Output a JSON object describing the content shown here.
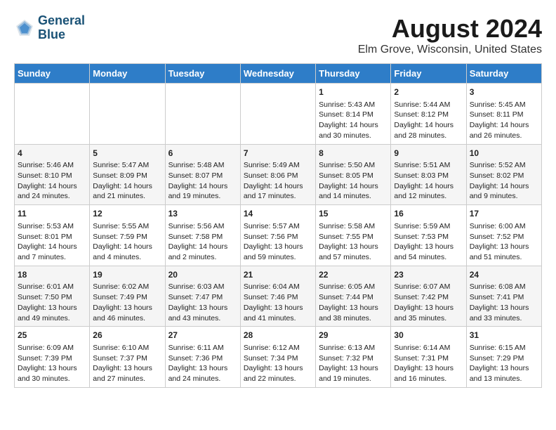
{
  "header": {
    "logo_line1": "General",
    "logo_line2": "Blue",
    "title": "August 2024",
    "subtitle": "Elm Grove, Wisconsin, United States"
  },
  "calendar": {
    "days_of_week": [
      "Sunday",
      "Monday",
      "Tuesday",
      "Wednesday",
      "Thursday",
      "Friday",
      "Saturday"
    ],
    "weeks": [
      [
        {
          "day": "",
          "info": ""
        },
        {
          "day": "",
          "info": ""
        },
        {
          "day": "",
          "info": ""
        },
        {
          "day": "",
          "info": ""
        },
        {
          "day": "1",
          "info": "Sunrise: 5:43 AM\nSunset: 8:14 PM\nDaylight: 14 hours\nand 30 minutes."
        },
        {
          "day": "2",
          "info": "Sunrise: 5:44 AM\nSunset: 8:12 PM\nDaylight: 14 hours\nand 28 minutes."
        },
        {
          "day": "3",
          "info": "Sunrise: 5:45 AM\nSunset: 8:11 PM\nDaylight: 14 hours\nand 26 minutes."
        }
      ],
      [
        {
          "day": "4",
          "info": "Sunrise: 5:46 AM\nSunset: 8:10 PM\nDaylight: 14 hours\nand 24 minutes."
        },
        {
          "day": "5",
          "info": "Sunrise: 5:47 AM\nSunset: 8:09 PM\nDaylight: 14 hours\nand 21 minutes."
        },
        {
          "day": "6",
          "info": "Sunrise: 5:48 AM\nSunset: 8:07 PM\nDaylight: 14 hours\nand 19 minutes."
        },
        {
          "day": "7",
          "info": "Sunrise: 5:49 AM\nSunset: 8:06 PM\nDaylight: 14 hours\nand 17 minutes."
        },
        {
          "day": "8",
          "info": "Sunrise: 5:50 AM\nSunset: 8:05 PM\nDaylight: 14 hours\nand 14 minutes."
        },
        {
          "day": "9",
          "info": "Sunrise: 5:51 AM\nSunset: 8:03 PM\nDaylight: 14 hours\nand 12 minutes."
        },
        {
          "day": "10",
          "info": "Sunrise: 5:52 AM\nSunset: 8:02 PM\nDaylight: 14 hours\nand 9 minutes."
        }
      ],
      [
        {
          "day": "11",
          "info": "Sunrise: 5:53 AM\nSunset: 8:01 PM\nDaylight: 14 hours\nand 7 minutes."
        },
        {
          "day": "12",
          "info": "Sunrise: 5:55 AM\nSunset: 7:59 PM\nDaylight: 14 hours\nand 4 minutes."
        },
        {
          "day": "13",
          "info": "Sunrise: 5:56 AM\nSunset: 7:58 PM\nDaylight: 14 hours\nand 2 minutes."
        },
        {
          "day": "14",
          "info": "Sunrise: 5:57 AM\nSunset: 7:56 PM\nDaylight: 13 hours\nand 59 minutes."
        },
        {
          "day": "15",
          "info": "Sunrise: 5:58 AM\nSunset: 7:55 PM\nDaylight: 13 hours\nand 57 minutes."
        },
        {
          "day": "16",
          "info": "Sunrise: 5:59 AM\nSunset: 7:53 PM\nDaylight: 13 hours\nand 54 minutes."
        },
        {
          "day": "17",
          "info": "Sunrise: 6:00 AM\nSunset: 7:52 PM\nDaylight: 13 hours\nand 51 minutes."
        }
      ],
      [
        {
          "day": "18",
          "info": "Sunrise: 6:01 AM\nSunset: 7:50 PM\nDaylight: 13 hours\nand 49 minutes."
        },
        {
          "day": "19",
          "info": "Sunrise: 6:02 AM\nSunset: 7:49 PM\nDaylight: 13 hours\nand 46 minutes."
        },
        {
          "day": "20",
          "info": "Sunrise: 6:03 AM\nSunset: 7:47 PM\nDaylight: 13 hours\nand 43 minutes."
        },
        {
          "day": "21",
          "info": "Sunrise: 6:04 AM\nSunset: 7:46 PM\nDaylight: 13 hours\nand 41 minutes."
        },
        {
          "day": "22",
          "info": "Sunrise: 6:05 AM\nSunset: 7:44 PM\nDaylight: 13 hours\nand 38 minutes."
        },
        {
          "day": "23",
          "info": "Sunrise: 6:07 AM\nSunset: 7:42 PM\nDaylight: 13 hours\nand 35 minutes."
        },
        {
          "day": "24",
          "info": "Sunrise: 6:08 AM\nSunset: 7:41 PM\nDaylight: 13 hours\nand 33 minutes."
        }
      ],
      [
        {
          "day": "25",
          "info": "Sunrise: 6:09 AM\nSunset: 7:39 PM\nDaylight: 13 hours\nand 30 minutes."
        },
        {
          "day": "26",
          "info": "Sunrise: 6:10 AM\nSunset: 7:37 PM\nDaylight: 13 hours\nand 27 minutes."
        },
        {
          "day": "27",
          "info": "Sunrise: 6:11 AM\nSunset: 7:36 PM\nDaylight: 13 hours\nand 24 minutes."
        },
        {
          "day": "28",
          "info": "Sunrise: 6:12 AM\nSunset: 7:34 PM\nDaylight: 13 hours\nand 22 minutes."
        },
        {
          "day": "29",
          "info": "Sunrise: 6:13 AM\nSunset: 7:32 PM\nDaylight: 13 hours\nand 19 minutes."
        },
        {
          "day": "30",
          "info": "Sunrise: 6:14 AM\nSunset: 7:31 PM\nDaylight: 13 hours\nand 16 minutes."
        },
        {
          "day": "31",
          "info": "Sunrise: 6:15 AM\nSunset: 7:29 PM\nDaylight: 13 hours\nand 13 minutes."
        }
      ]
    ]
  }
}
